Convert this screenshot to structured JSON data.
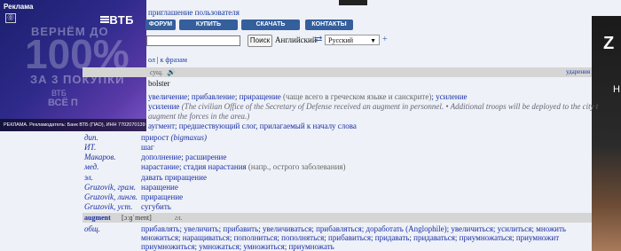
{
  "ad_left": {
    "label": "Реклама",
    "close": "⓪",
    "logo": "ВТБ",
    "line1": "ВЕРНЁМ ДО",
    "line2": "100%",
    "line3": "ЗА 3 ПОКУПКИ",
    "line4": "ВТБ",
    "line5": "ВСЁ П",
    "footer": "РЕКЛАМА. Рекламодатель: Банк ВТБ (ПАО), ИНН 7702070139"
  },
  "ad_right": {
    "letter1": "Z",
    "letter2": "H"
  },
  "header": {
    "user_link": "приглашение пользователя",
    "buttons": [
      "ФОРУМ",
      "КУПИТЬ",
      "СКАЧАТЬ",
      "КОНТАКТЫ"
    ]
  },
  "search": {
    "value": "",
    "button": "Поиск",
    "lang_from": "Английский",
    "lang_to": "Русский",
    "swap_icon": "⇄",
    "plus_icon": "+"
  },
  "phrase_links": {
    "a": "ол",
    "sep": " | ",
    "b": "к фразам"
  },
  "entry1": {
    "pos": "сущ.",
    "speaker": "🔊",
    "stress_link": "ударения",
    "variant": "bolster",
    "gen1": "увеличение; прибавление; приращение",
    "gen1_note": " (чаще всего в греческом языке и санскрите)",
    "gen1_end": "; усиление",
    "gen2": "усиление",
    "gen2_ex": " (The civilian Office of the Secretary of Defense received an augment in personnel. • Additional troops will be deployed to the city t",
    "gen3_ex": "augment the forces in the area.)",
    "gen4": "аугмент; предшествующий слог, прилагаемый к началу слова",
    "rows": [
      {
        "dom": "дип.",
        "tr": "прирост",
        "extra": " (bigmaxus)"
      },
      {
        "dom": "ИТ.",
        "tr": "шаг",
        "extra": ""
      },
      {
        "dom": "Макаров.",
        "tr": "дополнение; расширение",
        "extra": ""
      },
      {
        "dom": "мед.",
        "tr": "нарастание; стадия нарастания",
        "extra": " (напр., острого заболевания)"
      },
      {
        "dom": "эл.",
        "tr": "давать приращение",
        "extra": ""
      },
      {
        "dom": "Gruzovik, грам.",
        "tr": "наращение",
        "extra": ""
      },
      {
        "dom": "Gruzovik, лингв.",
        "tr": "приращение",
        "extra": ""
      },
      {
        "dom": "Gruzovik, уст.",
        "tr": "сугубить",
        "extra": ""
      }
    ]
  },
  "entry2": {
    "word": "augment",
    "pron": "[ɔːɡˈment]",
    "pos": "гл.",
    "dom": "общ.",
    "line1": "прибавлять; увеличить; прибавить; увеличиваться; прибавляться; доработать (Anglophile); увеличиться; усилиться; множить",
    "line2": "множиться; наращиваться; пополниться; пополняться; прибавиться; придавать; придаваться; приумножаться; приумножит",
    "line3": "приумножиться; умножаться; умножиться; приумножать"
  }
}
